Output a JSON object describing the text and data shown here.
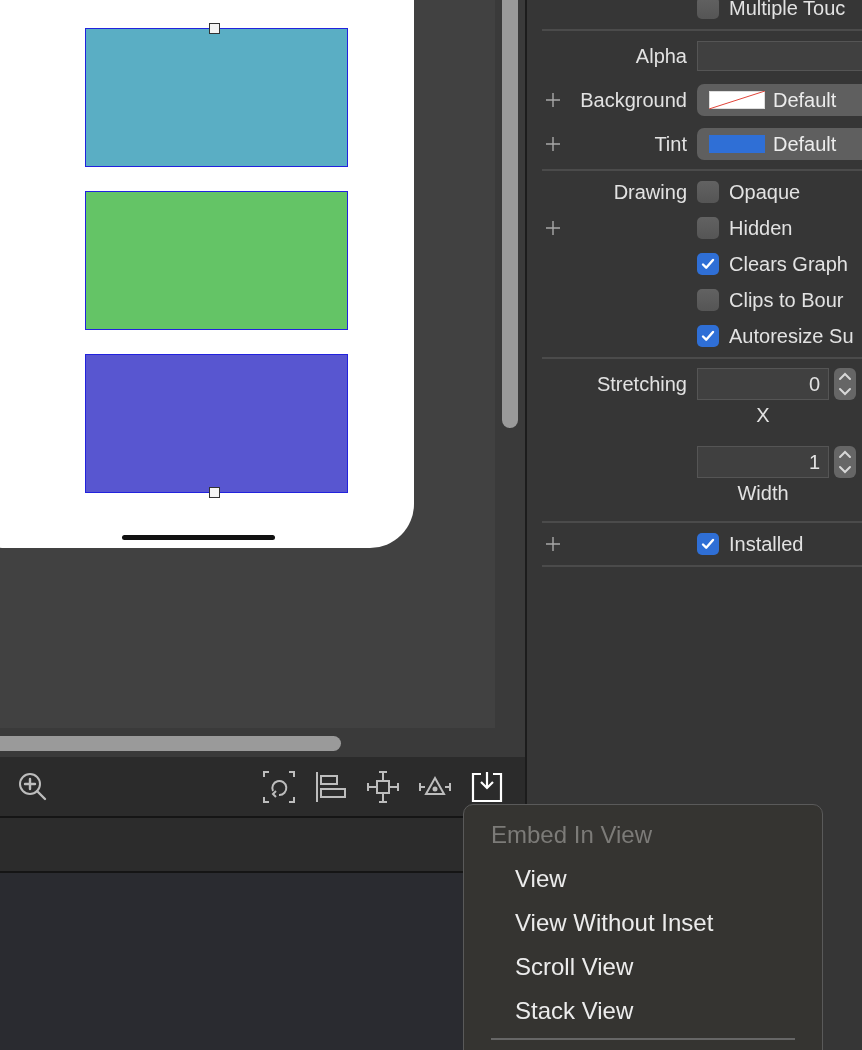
{
  "canvas": {
    "views": [
      {
        "color": "#5aaec4"
      },
      {
        "color": "#64c466"
      },
      {
        "color": "#5856d0"
      }
    ]
  },
  "toolbar": {
    "tools": [
      {
        "kind": "zoom",
        "selected": false
      },
      {
        "kind": "update-frames",
        "selected": false
      },
      {
        "kind": "align",
        "selected": false
      },
      {
        "kind": "pin",
        "selected": false
      },
      {
        "kind": "resolve",
        "selected": false
      },
      {
        "kind": "embed",
        "selected": true
      }
    ]
  },
  "inspector": {
    "rows": [
      {
        "kind": "checkbox",
        "plus": false,
        "text": "Multiple Touc",
        "checked": false
      },
      {
        "kind": "divider"
      },
      {
        "kind": "field",
        "plus": false,
        "label": "Alpha"
      },
      {
        "kind": "color",
        "plus": true,
        "label": "Background",
        "value": "Default"
      },
      {
        "kind": "color",
        "plus": true,
        "label": "Tint",
        "color": "#2f6fd6",
        "value": "Default"
      },
      {
        "kind": "divider"
      },
      {
        "kind": "checkbox",
        "plus": false,
        "label": "Drawing",
        "text": "Opaque",
        "checked": false
      },
      {
        "kind": "checkbox",
        "plus": true,
        "text": "Hidden",
        "checked": false
      },
      {
        "kind": "checkbox",
        "plus": false,
        "text": "Clears Graph",
        "checked": true
      },
      {
        "kind": "checkbox",
        "plus": false,
        "text": "Clips to Bour",
        "checked": false
      },
      {
        "kind": "checkbox",
        "plus": false,
        "text": "Autoresize Su",
        "checked": true
      },
      {
        "kind": "divider"
      },
      {
        "kind": "stepper",
        "plus": false,
        "label": "Stretching",
        "value": "0",
        "caption": "X"
      },
      {
        "kind": "stepper",
        "plus": false,
        "value": "1",
        "caption": "Width"
      },
      {
        "kind": "divider"
      },
      {
        "kind": "checkbox",
        "plus": true,
        "text": "Installed",
        "checked": true
      },
      {
        "kind": "divider"
      }
    ]
  },
  "menu": {
    "header": "Embed In View",
    "items": [
      "View",
      "View Without Inset",
      "Scroll View",
      "Stack View"
    ]
  }
}
